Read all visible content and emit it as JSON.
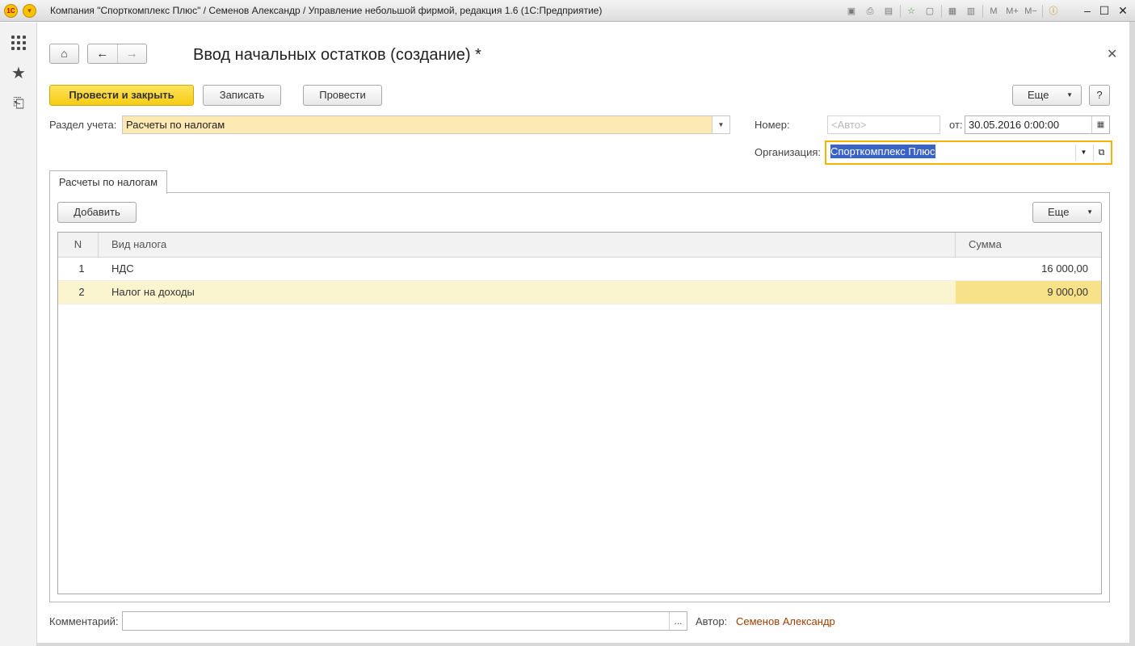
{
  "window": {
    "title": "Компания \"Спорткомплекс Плюс\" / Семенов Александр / Управление небольшой фирмой, редакция 1.6  (1С:Предприятие)",
    "logo_text": "1С",
    "toolbar_icons": [
      "save-icon",
      "print-icon",
      "preview-icon",
      "favorites-add-icon",
      "history-icon",
      "calculator-icon",
      "calendar-icon",
      "m-icon",
      "m-plus-icon",
      "m-minus-icon",
      "info-icon"
    ],
    "mem_labels": [
      "M",
      "M+",
      "M−"
    ]
  },
  "sidebar": {
    "items": [
      "apps-grid-icon",
      "favorites-star-icon",
      "history-icon"
    ]
  },
  "form": {
    "title": "Ввод начальных остатков (создание) *",
    "buttons": {
      "post_and_close": "Провести и закрыть",
      "save": "Записать",
      "post": "Провести",
      "more": "Еще",
      "help": "?"
    },
    "section_label": "Раздел учета:",
    "section_value": "Расчеты по налогам",
    "number_label": "Номер:",
    "number_placeholder": "<Авто>",
    "date_label": "от:",
    "date_value": "30.05.2016  0:00:00",
    "org_label": "Организация:",
    "org_value": "Спорткомплекс Плюс"
  },
  "tab": {
    "label": "Расчеты по налогам"
  },
  "table_toolbar": {
    "add": "Добавить",
    "more": "Еще"
  },
  "table": {
    "columns": [
      "N",
      "Вид налога",
      "Сумма"
    ],
    "rows": [
      {
        "n": "1",
        "tax": "НДС",
        "sum": "16 000,00"
      },
      {
        "n": "2",
        "tax": "Налог на доходы",
        "sum": "9 000,00"
      }
    ]
  },
  "footer": {
    "comment_label": "Комментарий:",
    "comment_value": "",
    "comment_btn": "...",
    "author_label": "Автор:",
    "author_value": "Семенов Александр"
  },
  "colors": {
    "accent_yellow": "#f7cc13",
    "selection_row": "#fbf5cf",
    "author_link": "#9c3d00",
    "focus_border": "#f2b400"
  }
}
